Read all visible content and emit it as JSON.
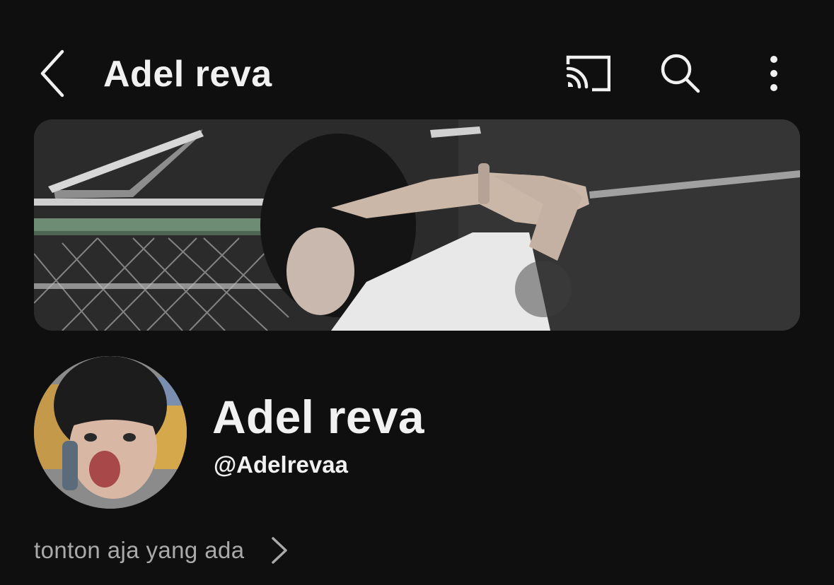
{
  "header": {
    "title": "Adel reva",
    "back_icon": "chevron-left-icon",
    "cast_icon": "cast-icon",
    "search_icon": "search-icon",
    "more_icon": "more-vertical-icon"
  },
  "banner": {
    "description_icon": "channel-banner-image"
  },
  "profile": {
    "name": "Adel reva",
    "handle": "@Adelrevaa",
    "description": "tonton aja yang ada",
    "more_icon": "chevron-right-icon"
  },
  "colors": {
    "background": "#0f0f0f",
    "text_primary": "#f1f1f1",
    "text_secondary": "#aaaaaa"
  }
}
